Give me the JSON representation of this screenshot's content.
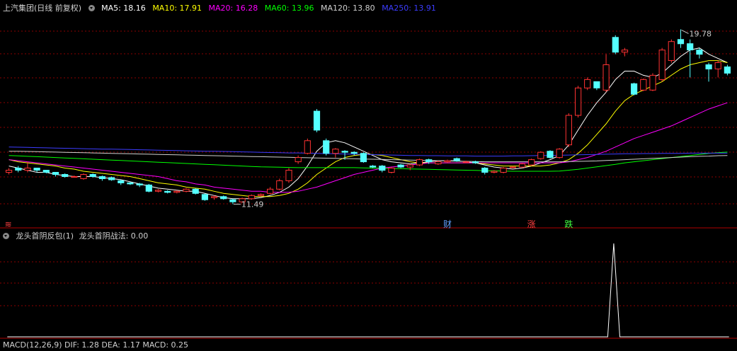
{
  "main_header": {
    "title": "上汽集团(日线 前复权)",
    "ma": [
      {
        "label": "MA5: 18.16",
        "color": "#ffffff"
      },
      {
        "label": "MA10: 17.91",
        "color": "#ffff00"
      },
      {
        "label": "MA20: 16.28",
        "color": "#ff00ff"
      },
      {
        "label": "MA60: 13.96",
        "color": "#00ff00"
      },
      {
        "label": "MA120: 13.80",
        "color": "#d0d0d0"
      },
      {
        "label": "MA250: 13.91",
        "color": "#3c3cff"
      }
    ]
  },
  "indicator_header": {
    "name": "龙头首阴反包(1)",
    "value_label": "龙头首阴战法: 0.00"
  },
  "macd_header": {
    "text": "MACD(12,26,9)  DIF: 1.28  DEA: 1.17  MACD: 0.25"
  },
  "colors": {
    "up": "#ff3232",
    "down": "#54ffff",
    "grid": "#8b0000",
    "divider": "#b00000"
  },
  "chart_data": [
    {
      "type": "candlestick",
      "title": "上汽集团(日线 前复权)",
      "y_range": [
        10.5,
        20.5
      ],
      "max_annotation": "19.78",
      "min_annotation": "11.49",
      "candles": [
        [
          13.0,
          13.1,
          12.9,
          13.2
        ],
        [
          13.2,
          13.1,
          13.0,
          13.3
        ],
        [
          13.1,
          13.2,
          13.0,
          13.5
        ],
        [
          13.2,
          13.1,
          13.0,
          13.2
        ],
        [
          13.1,
          13.0,
          12.95,
          13.1
        ],
        [
          13.0,
          12.9,
          12.8,
          13.0
        ],
        [
          12.9,
          12.8,
          12.75,
          12.95
        ],
        [
          12.8,
          12.8,
          12.75,
          12.85
        ],
        [
          12.7,
          12.9,
          12.65,
          12.95
        ],
        [
          12.9,
          12.8,
          12.75,
          12.95
        ],
        [
          12.8,
          12.7,
          12.6,
          12.85
        ],
        [
          12.75,
          12.65,
          12.6,
          12.8
        ],
        [
          12.6,
          12.5,
          12.4,
          12.65
        ],
        [
          12.5,
          12.45,
          12.4,
          12.55
        ],
        [
          12.45,
          12.4,
          12.3,
          12.5
        ],
        [
          12.4,
          12.1,
          12.05,
          12.45
        ],
        [
          12.1,
          12.15,
          12.05,
          12.2
        ],
        [
          12.1,
          12.05,
          12.0,
          12.15
        ],
        [
          12.05,
          12.1,
          12.0,
          12.15
        ],
        [
          12.1,
          12.2,
          12.05,
          12.25
        ],
        [
          12.2,
          12.0,
          11.95,
          12.25
        ],
        [
          11.95,
          11.7,
          11.65,
          12.0
        ],
        [
          11.8,
          11.85,
          11.7,
          11.9
        ],
        [
          11.85,
          11.75,
          11.7,
          11.9
        ],
        [
          11.7,
          11.6,
          11.49,
          11.75
        ],
        [
          11.6,
          11.75,
          11.55,
          11.8
        ],
        [
          11.75,
          11.9,
          11.7,
          11.95
        ],
        [
          11.9,
          11.95,
          11.85,
          12.0
        ],
        [
          12.0,
          12.2,
          11.95,
          12.3
        ],
        [
          12.2,
          12.6,
          12.15,
          12.7
        ],
        [
          12.6,
          13.1,
          12.5,
          13.2
        ],
        [
          13.5,
          13.7,
          13.4,
          13.8
        ],
        [
          13.9,
          14.5,
          13.85,
          14.6
        ],
        [
          15.9,
          15.0,
          14.9,
          16.0
        ],
        [
          14.5,
          13.9,
          13.8,
          14.6
        ],
        [
          13.9,
          14.1,
          13.7,
          14.15
        ],
        [
          14.0,
          13.95,
          13.6,
          14.05
        ],
        [
          13.95,
          13.9,
          13.8,
          14.0
        ],
        [
          13.9,
          13.5,
          13.45,
          13.95
        ],
        [
          13.3,
          13.25,
          13.2,
          13.35
        ],
        [
          13.3,
          13.1,
          13.0,
          13.35
        ],
        [
          13.0,
          13.2,
          12.95,
          13.25
        ],
        [
          13.35,
          13.25,
          13.2,
          13.4
        ],
        [
          13.25,
          13.35,
          13.1,
          13.4
        ],
        [
          13.35,
          13.6,
          13.3,
          13.65
        ],
        [
          13.6,
          13.5,
          13.4,
          13.65
        ],
        [
          13.4,
          13.5,
          13.35,
          13.55
        ],
        [
          13.5,
          13.55,
          13.45,
          13.6
        ],
        [
          13.65,
          13.55,
          13.5,
          13.7
        ],
        [
          13.5,
          13.5,
          13.45,
          13.55
        ],
        [
          13.5,
          13.45,
          13.4,
          13.55
        ],
        [
          13.2,
          13.0,
          12.9,
          13.25
        ],
        [
          13.0,
          13.05,
          12.95,
          13.1
        ],
        [
          13.0,
          13.2,
          12.95,
          13.25
        ],
        [
          13.25,
          13.25,
          13.2,
          13.3
        ],
        [
          13.25,
          13.4,
          13.2,
          13.45
        ],
        [
          13.35,
          13.6,
          13.3,
          13.65
        ],
        [
          13.65,
          13.95,
          13.6,
          14.0
        ],
        [
          14.0,
          13.7,
          13.65,
          14.05
        ],
        [
          13.7,
          14.1,
          13.65,
          14.15
        ],
        [
          14.3,
          15.7,
          14.2,
          15.8
        ],
        [
          15.7,
          17.0,
          15.6,
          17.1
        ],
        [
          17.0,
          17.4,
          16.9,
          17.5
        ],
        [
          17.3,
          17.0,
          16.9,
          17.3
        ],
        [
          16.9,
          18.1,
          16.8,
          18.6
        ],
        [
          19.4,
          18.7,
          18.6,
          19.5
        ],
        [
          18.7,
          18.8,
          18.5,
          18.9
        ],
        [
          17.2,
          16.7,
          16.65,
          17.25
        ],
        [
          16.9,
          17.4,
          16.85,
          17.45
        ],
        [
          16.9,
          17.6,
          16.85,
          17.7
        ],
        [
          17.4,
          18.8,
          17.3,
          18.9
        ],
        [
          18.3,
          19.2,
          18.2,
          19.3
        ],
        [
          19.3,
          19.1,
          18.9,
          19.78
        ],
        [
          19.1,
          18.8,
          17.5,
          19.3
        ],
        [
          18.8,
          18.6,
          18.4,
          18.9
        ],
        [
          18.1,
          17.9,
          17.3,
          18.2
        ],
        [
          17.9,
          18.2,
          17.5,
          18.3
        ],
        [
          18.0,
          17.7,
          17.6,
          18.1
        ]
      ],
      "ma_lines": [
        {
          "name": "MA5",
          "color": "#ffffff",
          "values": [
            13.3,
            13.2,
            13.1,
            13.0,
            13.0,
            12.9,
            12.85,
            12.8,
            12.8,
            12.8,
            12.75,
            12.7,
            12.65,
            12.55,
            12.45,
            12.35,
            12.25,
            12.2,
            12.15,
            12.1,
            12.1,
            12.0,
            11.9,
            11.8,
            11.75,
            11.75,
            11.75,
            11.8,
            11.9,
            12.05,
            12.3,
            12.7,
            13.3,
            14.0,
            14.4,
            14.5,
            14.4,
            14.2,
            14.0,
            13.8,
            13.6,
            13.5,
            13.45,
            13.4,
            13.45,
            13.5,
            13.55,
            13.55,
            13.55,
            13.5,
            13.45,
            13.35,
            13.25,
            13.2,
            13.15,
            13.2,
            13.3,
            13.45,
            13.6,
            13.8,
            14.3,
            15.0,
            15.7,
            16.3,
            16.8,
            17.4,
            17.8,
            17.8,
            17.6,
            17.5,
            17.7,
            18.1,
            18.5,
            18.8,
            18.9,
            18.6,
            18.4,
            18.2
          ]
        },
        {
          "name": "MA10",
          "color": "#ffff00",
          "values": [
            13.6,
            13.5,
            13.45,
            13.4,
            13.35,
            13.3,
            13.2,
            13.15,
            13.05,
            13.0,
            12.95,
            12.9,
            12.85,
            12.8,
            12.7,
            12.6,
            12.5,
            12.45,
            12.4,
            12.3,
            12.25,
            12.2,
            12.1,
            12.0,
            11.95,
            11.9,
            11.85,
            11.85,
            11.85,
            11.9,
            12.0,
            12.2,
            12.5,
            12.9,
            13.2,
            13.5,
            13.7,
            13.8,
            13.85,
            13.85,
            13.8,
            13.7,
            13.6,
            13.5,
            13.45,
            13.45,
            13.45,
            13.45,
            13.45,
            13.45,
            13.45,
            13.4,
            13.35,
            13.3,
            13.3,
            13.3,
            13.3,
            13.3,
            13.35,
            13.45,
            13.6,
            13.9,
            14.3,
            14.8,
            15.3,
            15.9,
            16.4,
            16.7,
            16.9,
            17.1,
            17.3,
            17.6,
            17.9,
            18.1,
            18.2,
            18.3,
            18.3,
            18.2
          ]
        },
        {
          "name": "MA20",
          "color": "#ff00ff",
          "values": [
            13.6,
            13.55,
            13.5,
            13.45,
            13.4,
            13.35,
            13.3,
            13.25,
            13.2,
            13.15,
            13.1,
            13.05,
            13.0,
            12.95,
            12.9,
            12.85,
            12.8,
            12.7,
            12.6,
            12.55,
            12.45,
            12.4,
            12.3,
            12.25,
            12.2,
            12.15,
            12.1,
            12.1,
            12.05,
            12.05,
            12.05,
            12.1,
            12.2,
            12.3,
            12.45,
            12.6,
            12.75,
            12.9,
            13.0,
            13.1,
            13.2,
            13.25,
            13.3,
            13.35,
            13.4,
            13.45,
            13.45,
            13.45,
            13.45,
            13.45,
            13.45,
            13.45,
            13.45,
            13.45,
            13.45,
            13.45,
            13.45,
            13.45,
            13.45,
            13.45,
            13.5,
            13.6,
            13.7,
            13.85,
            14.0,
            14.2,
            14.4,
            14.6,
            14.75,
            14.9,
            15.05,
            15.2,
            15.4,
            15.6,
            15.8,
            16.0,
            16.15,
            16.3
          ]
        },
        {
          "name": "MA60",
          "color": "#00ff00",
          "values": [
            13.8,
            13.78,
            13.76,
            13.74,
            13.72,
            13.7,
            13.68,
            13.66,
            13.64,
            13.62,
            13.6,
            13.58,
            13.56,
            13.54,
            13.52,
            13.5,
            13.48,
            13.46,
            13.44,
            13.42,
            13.4,
            13.38,
            13.36,
            13.34,
            13.32,
            13.3,
            13.28,
            13.26,
            13.25,
            13.24,
            13.23,
            13.22,
            13.22,
            13.22,
            13.22,
            13.22,
            13.22,
            13.22,
            13.21,
            13.2,
            13.19,
            13.18,
            13.17,
            13.16,
            13.15,
            13.14,
            13.13,
            13.12,
            13.11,
            13.1,
            13.09,
            13.08,
            13.07,
            13.06,
            13.05,
            13.05,
            13.05,
            13.05,
            13.05,
            13.06,
            13.1,
            13.14,
            13.2,
            13.26,
            13.32,
            13.38,
            13.45,
            13.5,
            13.55,
            13.6,
            13.65,
            13.7,
            13.75,
            13.8,
            13.85,
            13.9,
            13.93,
            13.96
          ]
        },
        {
          "name": "MA120",
          "color": "#d0d0d0",
          "values": [
            14.0,
            14.0,
            13.99,
            13.98,
            13.97,
            13.96,
            13.95,
            13.94,
            13.93,
            13.92,
            13.91,
            13.9,
            13.89,
            13.88,
            13.87,
            13.86,
            13.85,
            13.84,
            13.83,
            13.82,
            13.81,
            13.8,
            13.79,
            13.78,
            13.77,
            13.76,
            13.75,
            13.74,
            13.73,
            13.72,
            13.71,
            13.7,
            13.69,
            13.68,
            13.67,
            13.66,
            13.65,
            13.64,
            13.63,
            13.62,
            13.61,
            13.6,
            13.59,
            13.58,
            13.57,
            13.56,
            13.55,
            13.54,
            13.53,
            13.52,
            13.51,
            13.5,
            13.5,
            13.5,
            13.5,
            13.5,
            13.5,
            13.5,
            13.5,
            13.5,
            13.51,
            13.52,
            13.53,
            13.54,
            13.56,
            13.58,
            13.6,
            13.62,
            13.64,
            13.66,
            13.68,
            13.7,
            13.72,
            13.74,
            13.76,
            13.77,
            13.79,
            13.8
          ]
        },
        {
          "name": "MA250",
          "color": "#3c3cff",
          "values": [
            14.2,
            14.19,
            14.18,
            14.17,
            14.16,
            14.15,
            14.14,
            14.13,
            14.12,
            14.11,
            14.1,
            14.1,
            14.09,
            14.08,
            14.07,
            14.06,
            14.05,
            14.04,
            14.03,
            14.02,
            14.01,
            14.0,
            14.0,
            13.99,
            13.98,
            13.97,
            13.96,
            13.95,
            13.94,
            13.93,
            13.92,
            13.92,
            13.91,
            13.9,
            13.89,
            13.88,
            13.87,
            13.86,
            13.85,
            13.84,
            13.83,
            13.82,
            13.81,
            13.8,
            13.8,
            13.79,
            13.79,
            13.78,
            13.78,
            13.78,
            13.77,
            13.77,
            13.77,
            13.77,
            13.78,
            13.78,
            13.79,
            13.8,
            13.8,
            13.81,
            13.82,
            13.83,
            13.84,
            13.85,
            13.86,
            13.87,
            13.88,
            13.88,
            13.89,
            13.89,
            13.9,
            13.9,
            13.9,
            13.91,
            13.91,
            13.91,
            13.91,
            13.91
          ]
        }
      ],
      "event_markers": [
        {
          "index": 0,
          "text": "≋",
          "color": "#ff4040"
        },
        {
          "index": 47,
          "text": "财",
          "color": "#60a0ff"
        },
        {
          "index": 56,
          "text": "涨",
          "color": "#ff4040"
        },
        {
          "index": 60,
          "text": "跌",
          "color": "#40ff40"
        }
      ]
    },
    {
      "type": "line",
      "title": "龙头首阴反包(1)",
      "series": [
        {
          "name": "龙头首阴战法",
          "values": [
            0,
            0,
            0,
            0,
            0,
            0,
            0,
            0,
            0,
            0,
            0,
            0,
            0,
            0,
            0,
            0,
            0,
            0,
            0,
            0,
            0,
            0,
            0,
            0,
            0,
            0,
            0,
            0,
            0,
            0,
            0,
            0,
            0,
            0,
            0,
            0,
            0,
            0,
            0,
            0,
            0,
            0,
            0,
            0,
            0,
            0,
            0,
            0,
            0,
            0,
            0,
            0,
            0,
            0,
            0,
            0,
            0,
            0,
            0,
            0,
            0,
            0,
            0,
            0,
            0,
            0,
            0,
            0,
            0,
            0,
            0,
            0,
            0,
            0,
            0,
            0,
            0,
            0,
            0,
            0,
            0,
            0,
            0,
            0,
            0,
            0,
            0,
            0,
            0,
            0,
            0,
            0,
            0,
            0,
            0,
            0,
            0,
            0,
            0,
            0,
            1,
            0,
            0,
            0,
            0,
            0,
            0,
            0,
            0,
            0,
            0,
            0,
            0,
            0,
            0,
            0,
            0,
            0,
            0,
            0
          ]
        }
      ],
      "y_range": [
        0,
        1
      ]
    }
  ]
}
